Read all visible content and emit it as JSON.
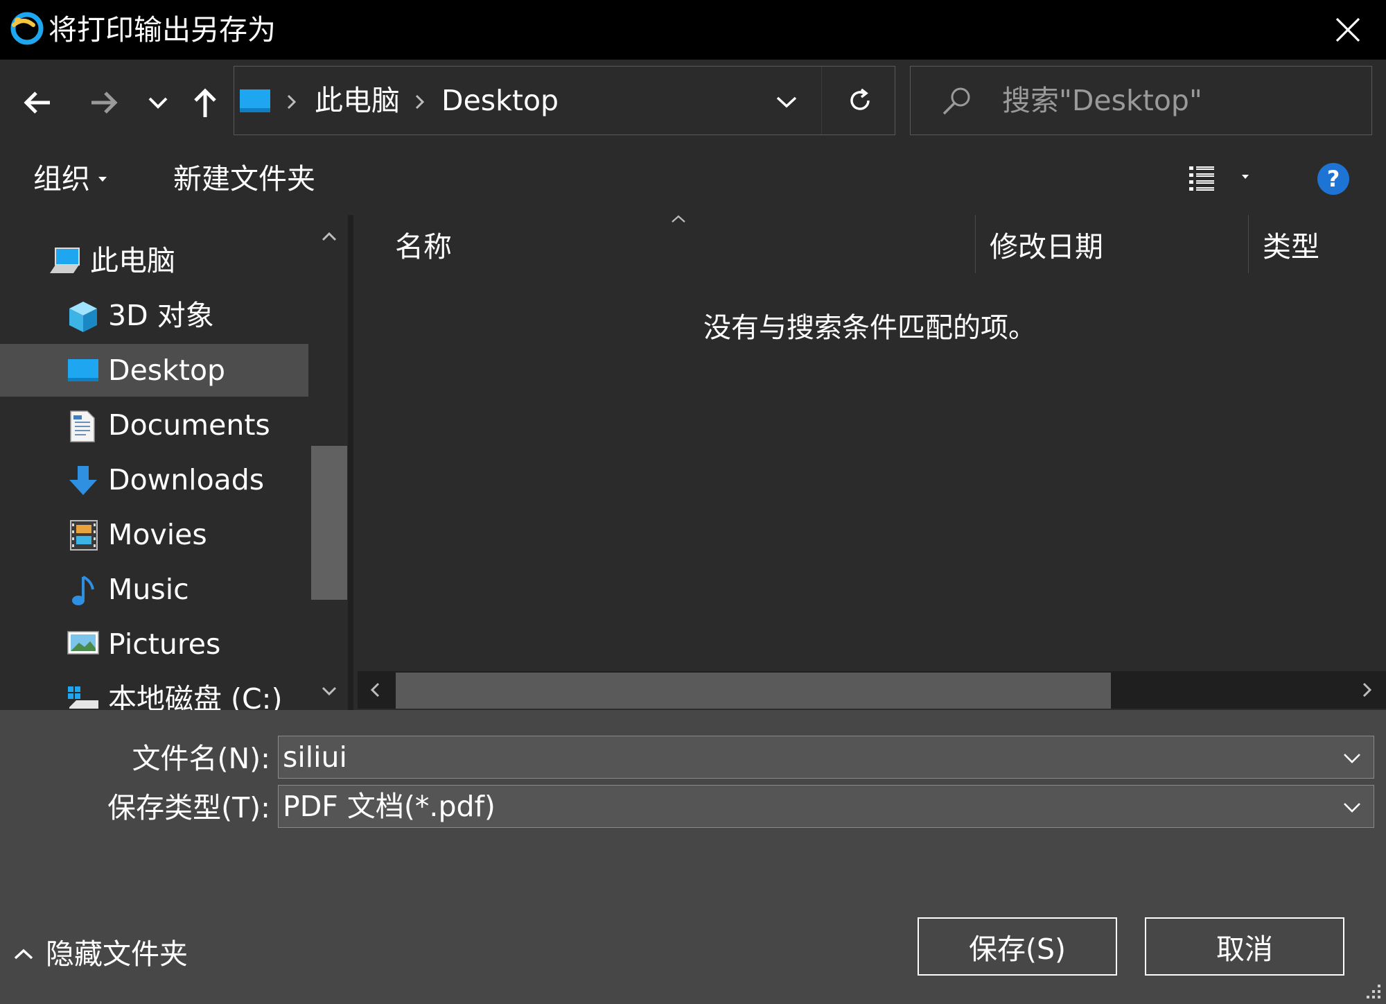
{
  "window": {
    "title": "将打印输出另存为"
  },
  "address": {
    "crumbs": [
      "此电脑",
      "Desktop"
    ],
    "search_placeholder": "搜索\"Desktop\""
  },
  "toolbar": {
    "organize_label": "组织",
    "new_folder_label": "新建文件夹"
  },
  "nav": {
    "items": [
      {
        "label": "此电脑",
        "icon": "computer-icon"
      },
      {
        "label": "3D 对象",
        "icon": "3d-objects-icon"
      },
      {
        "label": "Desktop",
        "icon": "desktop-folder-icon",
        "selected": true
      },
      {
        "label": "Documents",
        "icon": "documents-icon"
      },
      {
        "label": "Downloads",
        "icon": "downloads-icon"
      },
      {
        "label": "Movies",
        "icon": "movies-icon"
      },
      {
        "label": "Music",
        "icon": "music-icon"
      },
      {
        "label": "Pictures",
        "icon": "pictures-icon"
      },
      {
        "label": "本地磁盘 (C:)",
        "icon": "drive-icon"
      }
    ]
  },
  "content": {
    "columns": [
      "名称",
      "修改日期",
      "类型"
    ],
    "empty_message": "没有与搜索条件匹配的项。"
  },
  "form": {
    "filename_label": "文件名(N):",
    "filename_value": "siliui",
    "filetype_label": "保存类型(T):",
    "filetype_value": "PDF 文档(*.pdf)"
  },
  "footer": {
    "hide_folders_label": "隐藏文件夹",
    "save_label": "保存(S)",
    "cancel_label": "取消"
  },
  "colors": {
    "titlebar": "#000000",
    "background": "#2b2b2b",
    "bottom_panel": "#474747",
    "selected_item": "#4d4d4d",
    "accent": "#1ea6f0"
  }
}
